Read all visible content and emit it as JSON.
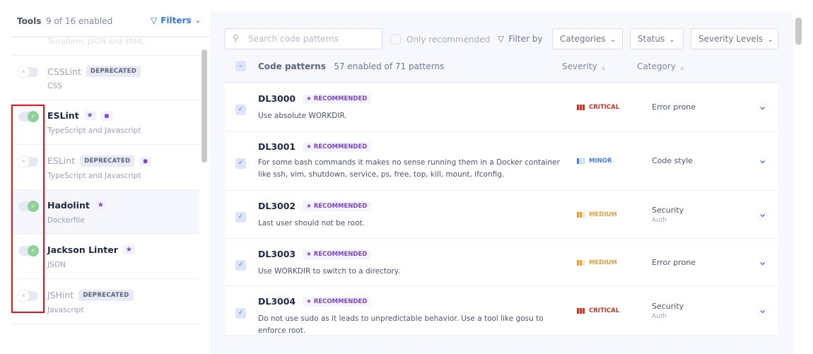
{
  "tools_panel": {
    "title": "Tools",
    "count": "9 of 16 enabled",
    "filters_label": "Filters",
    "partial_item_sub": "Terraform, JSON and YAML",
    "items": [
      {
        "name": "CSSLint",
        "sub": "CSS",
        "enabled": false,
        "deprecated": true,
        "badge": "DEPRECATED",
        "star": false,
        "doc": false
      },
      {
        "name": "ESLint",
        "sub": "TypeScript and Javascript",
        "enabled": true,
        "deprecated": false,
        "star": true,
        "doc": true
      },
      {
        "name": "ESLint",
        "sub": "TypeScript and Javascript",
        "enabled": false,
        "deprecated": true,
        "badge": "DEPRECATED",
        "star": false,
        "doc": true
      },
      {
        "name": "Hadolint",
        "sub": "Dockerfile",
        "enabled": true,
        "deprecated": false,
        "star": true,
        "doc": false,
        "highlighted": true
      },
      {
        "name": "Jackson Linter",
        "sub": "JSON",
        "enabled": true,
        "deprecated": false,
        "star": true,
        "doc": false
      },
      {
        "name": "JSHint",
        "sub": "Javascript",
        "enabled": false,
        "deprecated": true,
        "badge": "DEPRECATED",
        "star": false,
        "doc": false
      }
    ]
  },
  "patterns_panel": {
    "search_placeholder": "Search code patterns",
    "only_recommended": "Only recommended",
    "filter_by": "Filter by",
    "dropdowns": [
      "Categories",
      "Status",
      "Severity Levels"
    ],
    "header": {
      "title": "Code patterns",
      "count": "57 enabled of 71 patterns",
      "severity": "Severity",
      "category": "Category"
    },
    "recommended_label": "RECOMMENDED",
    "rows": [
      {
        "code": "DL3000",
        "desc": "Use absolute WORKDIR.",
        "severity": "CRITICAL",
        "category": "Error prone",
        "subcategory": "",
        "checked": true
      },
      {
        "code": "DL3001",
        "desc": "For some bash commands it makes no sense running them in a Docker container like ssh, vim, shutdown, service, ps, free, top, kill, mount, ifconfig.",
        "severity": "MINOR",
        "category": "Code style",
        "subcategory": "",
        "checked": true
      },
      {
        "code": "DL3002",
        "desc": "Last user should not be root.",
        "severity": "MEDIUM",
        "category": "Security",
        "subcategory": "Auth",
        "checked": true
      },
      {
        "code": "DL3003",
        "desc": "Use WORKDIR to switch to a directory.",
        "severity": "MEDIUM",
        "category": "Error prone",
        "subcategory": "",
        "checked": true
      },
      {
        "code": "DL3004",
        "desc": "Do not use sudo as it leads to unpredictable behavior. Use a tool like gosu to enforce root.",
        "severity": "CRITICAL",
        "category": "Security",
        "subcategory": "Auth",
        "checked": true
      }
    ]
  },
  "colors": {
    "accent": "#3a72e8",
    "critical": "#c0392b",
    "minor": "#4a7bef",
    "medium": "#e3a04a",
    "recommended": "#7a45d6",
    "toggle_on": "#8fd19b",
    "highlight_box": "#e8121b"
  }
}
